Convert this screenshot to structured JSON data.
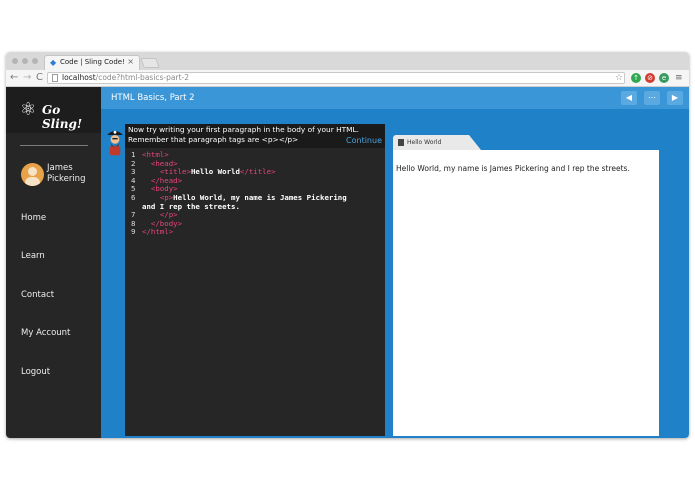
{
  "browser": {
    "tab_title": "Code | Sling Code!",
    "close_symbol": "×",
    "url_host": "localhost",
    "url_path": "/code?html-basics-part-2",
    "nav_back": "←",
    "nav_forward": "→",
    "nav_reload": "C"
  },
  "sidebar": {
    "logo_text": "Go Sling!",
    "user_name": "James Pickering",
    "items": [
      {
        "label": "Home"
      },
      {
        "label": "Learn"
      },
      {
        "label": "Contact"
      },
      {
        "label": "My Account"
      },
      {
        "label": "Logout"
      }
    ]
  },
  "lesson": {
    "title": "HTML Basics, Part 2",
    "prompt_line1": "Now try writing your first paragraph in the body of your HTML.",
    "prompt_line2": "Remember that paragraph tags are <p></p>",
    "continue_label": "Continue"
  },
  "code": {
    "lines": [
      {
        "n": "1",
        "pre": "",
        "open": "<html>",
        "text": "",
        "close": ""
      },
      {
        "n": "2",
        "pre": "  ",
        "open": "<head>",
        "text": "",
        "close": ""
      },
      {
        "n": "3",
        "pre": "    ",
        "open": "<title>",
        "text": "Hello World",
        "close": "</title>"
      },
      {
        "n": "4",
        "pre": "  ",
        "open": "</head>",
        "text": "",
        "close": ""
      },
      {
        "n": "5",
        "pre": "  ",
        "open": "<body>",
        "text": "",
        "close": ""
      },
      {
        "n": "6",
        "pre": "    ",
        "open": "<p>",
        "text": "Hello World, my name is James Pickering",
        "close": ""
      },
      {
        "n": "",
        "pre": "",
        "open": "",
        "text": "and I rep the streets.",
        "close": ""
      },
      {
        "n": "7",
        "pre": "    ",
        "open": "</p>",
        "text": "",
        "close": ""
      },
      {
        "n": "8",
        "pre": "  ",
        "open": "</body>",
        "text": "",
        "close": ""
      },
      {
        "n": "9",
        "pre": "",
        "open": "</html>",
        "text": "",
        "close": ""
      }
    ]
  },
  "preview": {
    "tab_title": "Hello World",
    "text": "Hello World, my name is James Pickering and I rep the streets."
  },
  "colors": {
    "main_bg": "#1f82c9",
    "sidebar_bg": "#262626",
    "code_tag": "#e8457a",
    "continue": "#4aa3df"
  }
}
